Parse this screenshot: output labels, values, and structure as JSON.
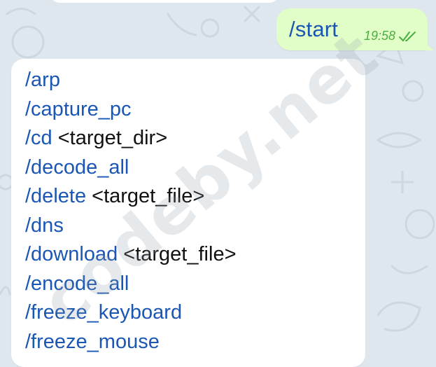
{
  "outgoing": {
    "text": "/start",
    "time": "19:58",
    "status_icon": "double-check-icon"
  },
  "incoming": {
    "commands": [
      {
        "cmd": "/arp",
        "arg": ""
      },
      {
        "cmd": "/capture_pc",
        "arg": ""
      },
      {
        "cmd": "/cd",
        "arg": " <target_dir>"
      },
      {
        "cmd": "/decode_all",
        "arg": ""
      },
      {
        "cmd": "/delete",
        "arg": " <target_file>"
      },
      {
        "cmd": "/dns",
        "arg": ""
      },
      {
        "cmd": "/download",
        "arg": " <target_file>"
      },
      {
        "cmd": "/encode_all",
        "arg": ""
      },
      {
        "cmd": "/freeze_keyboard",
        "arg": ""
      },
      {
        "cmd": "/freeze_mouse",
        "arg": ""
      }
    ]
  },
  "watermark": "codeby.net",
  "colors": {
    "link": "#1a56b4",
    "out_bubble": "#e2fec8",
    "time": "#4cae3f",
    "wallpaper": "#dfe7ee"
  }
}
